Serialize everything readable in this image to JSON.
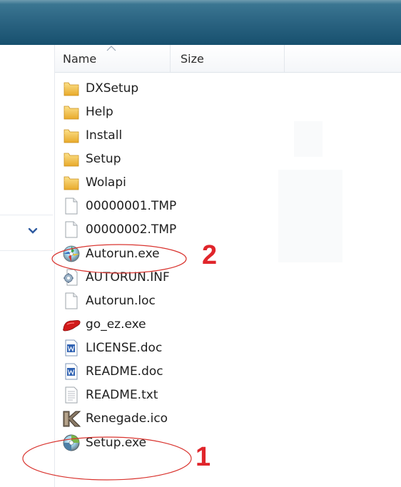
{
  "header": {
    "columns": [
      {
        "label": "Name"
      },
      {
        "label": "Size"
      }
    ]
  },
  "files": [
    {
      "name": "DXSetup",
      "icon": "folder-icon"
    },
    {
      "name": "Help",
      "icon": "folder-icon"
    },
    {
      "name": "Install",
      "icon": "folder-icon"
    },
    {
      "name": "Setup",
      "icon": "folder-icon"
    },
    {
      "name": "Wolapi",
      "icon": "folder-icon"
    },
    {
      "name": "00000001.TMP",
      "icon": "blank-file-icon"
    },
    {
      "name": "00000002.TMP",
      "icon": "blank-file-icon"
    },
    {
      "name": "Autorun.exe",
      "icon": "autorun-exe-icon"
    },
    {
      "name": "AUTORUN.INF",
      "icon": "config-file-icon"
    },
    {
      "name": "Autorun.loc",
      "icon": "blank-file-icon"
    },
    {
      "name": "go_ez.exe",
      "icon": "red-app-icon"
    },
    {
      "name": "LICENSE.doc",
      "icon": "word-doc-icon"
    },
    {
      "name": "README.doc",
      "icon": "word-doc-icon"
    },
    {
      "name": "README.txt",
      "icon": "text-file-icon"
    },
    {
      "name": "Renegade.ico",
      "icon": "renegade-logo-icon"
    },
    {
      "name": "Setup.exe",
      "icon": "setup-exe-icon"
    }
  ],
  "annotations": [
    {
      "label": "2",
      "target": "Autorun.exe",
      "color": "#e0252b"
    },
    {
      "label": "1",
      "target": "Setup.exe",
      "color": "#e0252b"
    }
  ],
  "colors": {
    "titlebar": "#2c6583",
    "annotation": "#e0252b",
    "folder": "#f2c14e"
  }
}
